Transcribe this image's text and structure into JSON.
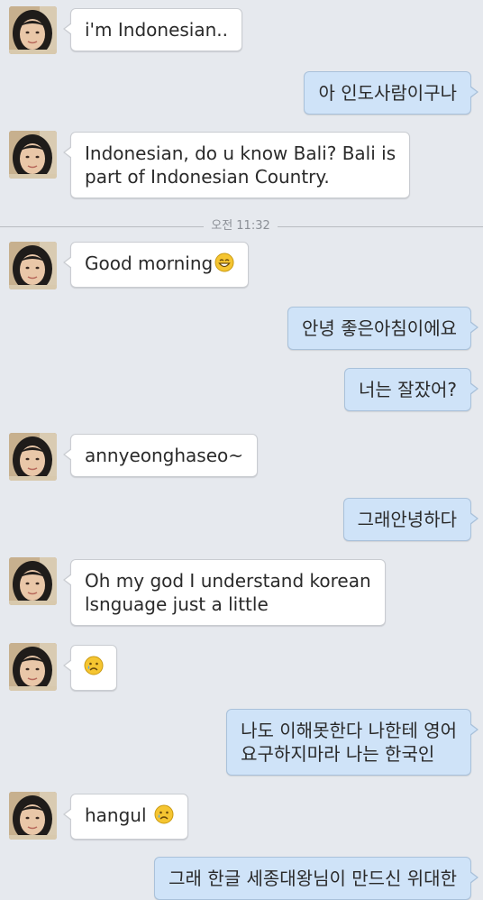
{
  "messages": [
    {
      "from": "them",
      "text": "i'm Indonesian.."
    },
    {
      "from": "me",
      "text": "아 인도사람이구나"
    },
    {
      "from": "them",
      "lines": [
        "Indonesian, do u know Bali? Bali is",
        "part of Indonesian Country."
      ]
    },
    {
      "from": "me",
      "text": "안녕 좋은아침이에요"
    },
    {
      "from": "them",
      "text": "Good morning",
      "emoji": "grinning-face-emoji"
    },
    {
      "from": "me",
      "text": "너는 잘잤어?"
    },
    {
      "from": "them",
      "text": "annyeonghaseo~"
    },
    {
      "from": "me",
      "text": "그래안녕하다"
    },
    {
      "from": "them",
      "lines": [
        "Oh my god I understand korean",
        "lsnguage just a little"
      ]
    },
    {
      "from": "them",
      "emoji": "crying-face-emoji"
    },
    {
      "from": "me",
      "lines": [
        "나도 이해못한다 나한테 영어",
        "요구하지마라 나는 한국인"
      ]
    },
    {
      "from": "them",
      "text": "hangul",
      "emoji": "crying-face-emoji"
    },
    {
      "from": "me",
      "text": "그래 한글 세종대왕님이 만드신 위대한"
    }
  ],
  "divider": {
    "time": "오전 11:32"
  },
  "colors": {
    "background": "#e6e9ee",
    "incoming_bubble": "#ffffff",
    "outgoing_bubble": "#cfe3f8",
    "emoji_face": "#f5c531"
  }
}
